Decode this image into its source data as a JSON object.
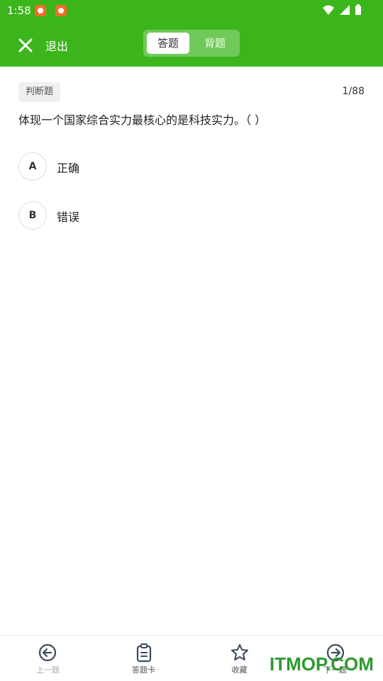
{
  "status": {
    "time": "1:58"
  },
  "header": {
    "exit_label": "退出",
    "tabs": [
      {
        "label": "答题",
        "active": true
      },
      {
        "label": "背题",
        "active": false
      }
    ]
  },
  "question": {
    "type_tag": "判断题",
    "progress": "1/88",
    "text": "体现一个国家综合实力最核心的是科技实力。（ ）",
    "options": [
      {
        "letter": "A",
        "text": "正确"
      },
      {
        "letter": "B",
        "text": "错误"
      }
    ]
  },
  "bottom_nav": [
    {
      "label": "上一题",
      "icon": "arrow-left-circle-icon"
    },
    {
      "label": "答题卡",
      "icon": "clipboard-icon"
    },
    {
      "label": "收藏",
      "icon": "star-icon"
    },
    {
      "label": "下一题",
      "icon": "arrow-right-circle-icon"
    }
  ],
  "watermark": "ITMOP.COM",
  "colors": {
    "brand": "#3bb51b",
    "watermark": "#2e9a2e"
  }
}
